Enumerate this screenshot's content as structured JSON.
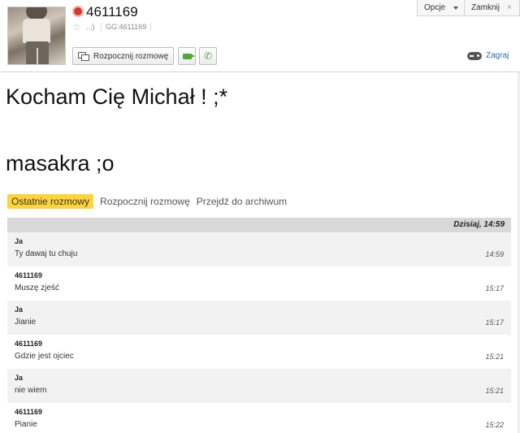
{
  "header": {
    "contact_name": "4611169",
    "status_description": "..;)",
    "gg_number": "GG:4611169",
    "start_chat_label": "Rozpocznij rozmowę",
    "options_label": "Opcje",
    "close_label": "Zamknij",
    "close_glyph": "×",
    "play_label": "Zagraj",
    "star_glyph": "☆",
    "phone_glyph": "✆",
    "status_color": "#d43a2c",
    "icons": [
      "status-icon",
      "star-icon",
      "chat-icon",
      "video-icon",
      "phone-icon",
      "caret-down-icon",
      "close-icon",
      "gamepad-icon"
    ]
  },
  "description": {
    "line1": "Kocham Cię Michał ! ;*",
    "line2": "masakra ;o"
  },
  "tabs": [
    {
      "label": "Ostatnie rozmowy",
      "active": true
    },
    {
      "label": "Rozpocznij rozmowę",
      "active": false
    },
    {
      "label": "Przejdź do archiwum",
      "active": false
    }
  ],
  "conversation": {
    "date_header": "Dzisiaj, 14:59",
    "messages": [
      {
        "sender": "Ja",
        "text": "Ty dawaj tu chuju",
        "time": "14:59"
      },
      {
        "sender": "4611169",
        "text": "Muszę zjeść",
        "time": "15:17"
      },
      {
        "sender": "Ja",
        "text": "Jianie",
        "time": "15:17"
      },
      {
        "sender": "4611169",
        "text": "Gdzie jest ojciec",
        "time": "15:21"
      },
      {
        "sender": "Ja",
        "text": "nie wiem",
        "time": "15:21"
      },
      {
        "sender": "4611169",
        "text": "Pianie",
        "time": "15:22"
      }
    ]
  },
  "colors": {
    "accent_tab": "#ffd43b",
    "link": "#2a6db5",
    "call_green": "#4caa35"
  }
}
